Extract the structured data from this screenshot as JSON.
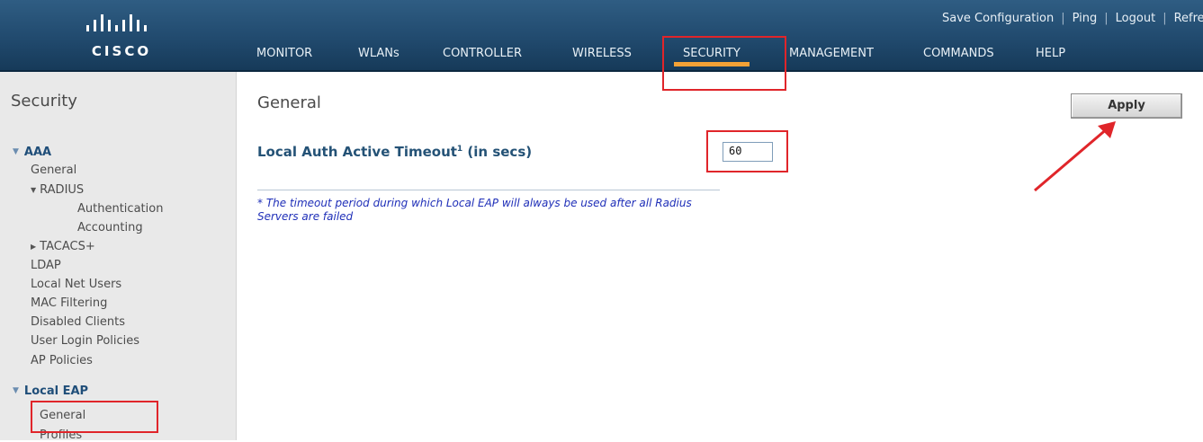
{
  "brand": {
    "logo_text": "CISCO",
    "logo_icon": "cisco-bars-icon"
  },
  "utility_links": {
    "save": "Save Configuration",
    "ping": "Ping",
    "logout": "Logout",
    "refresh": "Refres",
    "separator": "|"
  },
  "tabs": [
    {
      "label": "MONITOR"
    },
    {
      "label": "WLANs"
    },
    {
      "label": "CONTROLLER"
    },
    {
      "label": "WIRELESS"
    },
    {
      "label": "SECURITY"
    },
    {
      "label": "MANAGEMENT"
    },
    {
      "label": "COMMANDS"
    },
    {
      "label": "HELP"
    }
  ],
  "active_tab": "SECURITY",
  "sidebar": {
    "title": "Security",
    "aaa": {
      "label": "AAA",
      "items": [
        "General",
        "RADIUS",
        "Authentication",
        "Accounting",
        "TACACS+",
        "LDAP",
        "Local Net Users",
        "MAC Filtering",
        "Disabled Clients",
        "User Login Policies",
        "AP Policies"
      ]
    },
    "local_eap": {
      "label": "Local EAP",
      "items": [
        "General",
        "Profiles"
      ]
    }
  },
  "main": {
    "title": "General",
    "apply_label": "Apply",
    "field_label": "Local Auth Active Timeout",
    "field_footnote_mark": "1",
    "field_suffix": "(in secs)",
    "timeout_value": "60",
    "note": "* The timeout period during which Local EAP will always be used after all Radius Servers are failed"
  },
  "colors": {
    "header": "#214a6e",
    "tab_active_underline": "#f4a236",
    "highlight": "#e0252a",
    "label_blue": "#245276",
    "note_blue": "#1f2fb8"
  }
}
